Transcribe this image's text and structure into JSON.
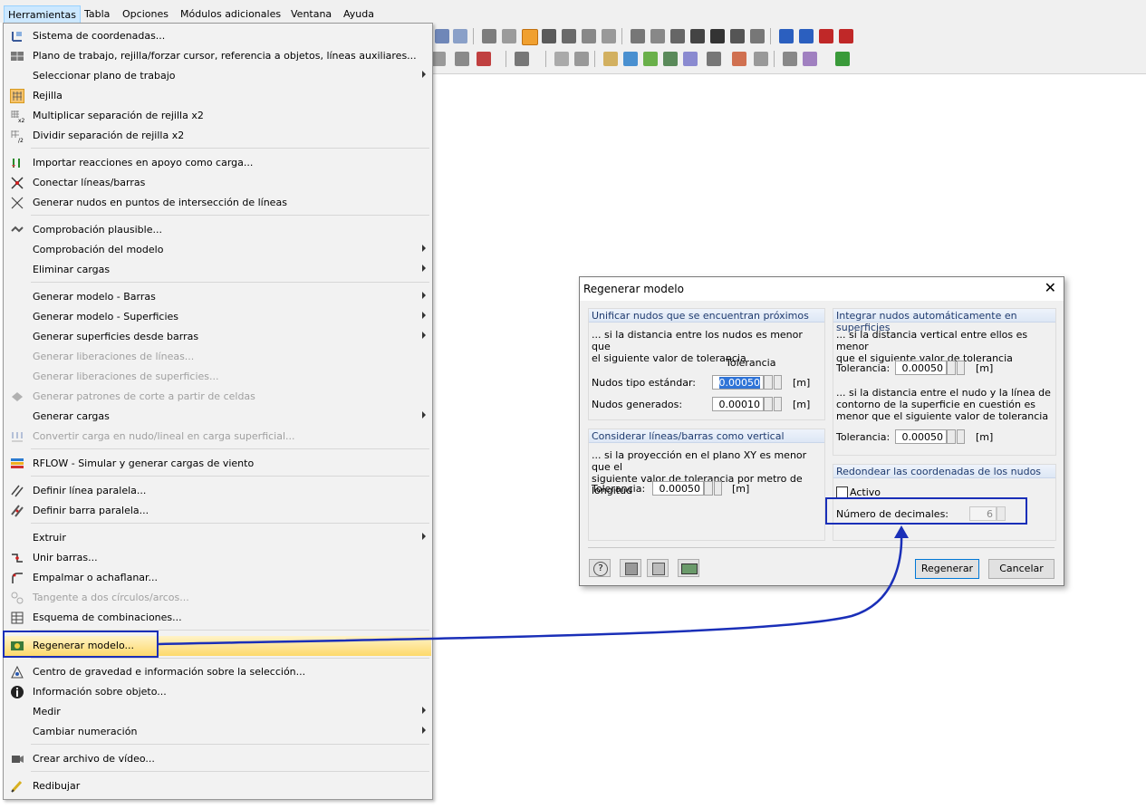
{
  "menubar": {
    "items": [
      "Herramientas",
      "Tabla",
      "Opciones",
      "Módulos adicionales",
      "Ventana",
      "Ayuda"
    ]
  },
  "menu": {
    "items": [
      {
        "label": "Sistema de coordenadas...",
        "icon": "coordinate-system-icon"
      },
      {
        "label": "Plano de trabajo, rejilla/forzar cursor, referencia a objetos, líneas auxiliares...",
        "icon": "work-plane-icon"
      },
      {
        "label": "Seleccionar plano de trabajo",
        "submenu": true
      },
      {
        "label": "Rejilla",
        "icon": "grid-icon"
      },
      {
        "label": "Multiplicar separación de rejilla x2",
        "icon": "grid-multiply-icon"
      },
      {
        "label": "Dividir separación de rejilla x2",
        "icon": "grid-divide-icon"
      },
      {
        "label": "Importar reacciones en apoyo como carga...",
        "icon": "import-reactions-icon"
      },
      {
        "label": "Conectar líneas/barras",
        "icon": "connect-lines-icon"
      },
      {
        "label": "Generar nudos en puntos de intersección de líneas",
        "icon": "intersection-nodes-icon"
      },
      {
        "label": "Comprobación plausible...",
        "icon": "plausibility-check-icon"
      },
      {
        "label": "Comprobación del modelo",
        "submenu": true
      },
      {
        "label": "Eliminar cargas",
        "submenu": true
      },
      {
        "label": "Generar modelo - Barras",
        "submenu": true
      },
      {
        "label": "Generar modelo - Superficies",
        "submenu": true
      },
      {
        "label": "Generar superficies desde barras",
        "submenu": true
      },
      {
        "label": "Generar liberaciones de líneas...",
        "disabled": true
      },
      {
        "label": "Generar liberaciones de superficies...",
        "disabled": true
      },
      {
        "label": "Generar patrones de corte a partir de celdas",
        "disabled": true,
        "icon": "cutting-pattern-icon"
      },
      {
        "label": "Generar cargas",
        "submenu": true
      },
      {
        "label": "Convertir carga en nudo/lineal en carga superficial...",
        "disabled": true,
        "icon": "convert-load-icon"
      },
      {
        "label": "RFLOW - Simular y generar cargas de viento",
        "icon": "rflow-icon"
      },
      {
        "label": "Definir línea paralela...",
        "icon": "parallel-line-icon"
      },
      {
        "label": "Definir barra paralela...",
        "icon": "parallel-member-icon"
      },
      {
        "label": "Extruir",
        "submenu": true
      },
      {
        "label": "Unir barras...",
        "icon": "join-members-icon"
      },
      {
        "label": "Empalmar o achaflanar...",
        "icon": "fillet-icon"
      },
      {
        "label": "Tangente a dos círculos/arcos...",
        "disabled": true,
        "icon": "tangent-icon"
      },
      {
        "label": "Esquema de combinaciones...",
        "icon": "combination-scheme-icon"
      },
      {
        "label": "Regenerar modelo...",
        "icon": "regenerate-model-icon",
        "highlighted": true
      },
      {
        "label": "Centro de gravedad e información sobre la selección...",
        "icon": "center-of-gravity-icon"
      },
      {
        "label": "Información sobre objeto...",
        "icon": "object-info-icon"
      },
      {
        "label": "Medir",
        "submenu": true
      },
      {
        "label": "Cambiar numeración",
        "submenu": true
      },
      {
        "label": "Crear archivo de vídeo...",
        "icon": "video-icon"
      },
      {
        "label": "Redibujar",
        "icon": "redraw-icon"
      }
    ]
  },
  "dialog": {
    "title": "Regenerar modelo",
    "unify": {
      "header": "Unificar nudos que se encuentran próximos",
      "desc1": "... si la distancia entre los nudos es menor que",
      "desc2": "el siguiente valor de tolerancia",
      "tol_header": "Tolerancia",
      "std_label": "Nudos tipo estándar:",
      "std_value": "0.00050",
      "gen_label": "Nudos generados:",
      "gen_value": "0.00010",
      "unit": "[m]"
    },
    "vertical": {
      "header": "Considerar líneas/barras como vertical",
      "desc1": "... si la proyección en el plano XY es menor que el",
      "desc2": "siguiente valor de tolerancia por metro de longitud",
      "tol_label": "Tolerancia:",
      "tol_value": "0.00050",
      "unit": "[m]"
    },
    "integrate": {
      "header": "Integrar nudos automáticamente en superficies",
      "desc1": "... si la distancia vertical entre ellos es menor",
      "desc2": "que el siguiente valor de tolerancia",
      "tol1_label": "Tolerancia:",
      "tol1_value": "0.00050",
      "desc3": "... si la distancia entre el nudo y la línea de",
      "desc4": "contorno de la superficie en cuestión es",
      "desc5": "menor que el siguiente valor de tolerancia",
      "tol2_label": "Tolerancia:",
      "tol2_value": "0.00050",
      "unit": "[m]"
    },
    "rounding": {
      "header": "Redondear las coordenadas de los nudos",
      "active_label": "Activo",
      "active_checked": false,
      "decimals_label": "Número de decimales:",
      "decimals_value": "6"
    },
    "buttons": {
      "regenerate": "Regenerar",
      "cancel": "Cancelar",
      "icons": [
        "help-icon",
        "load-defaults-icon",
        "save-defaults-icon",
        "decimal-places-icon"
      ]
    }
  },
  "colors": {
    "highlight_box": "#1a2fb8",
    "menu_highlight": "#fdd96b",
    "selection": "#3074d7"
  }
}
